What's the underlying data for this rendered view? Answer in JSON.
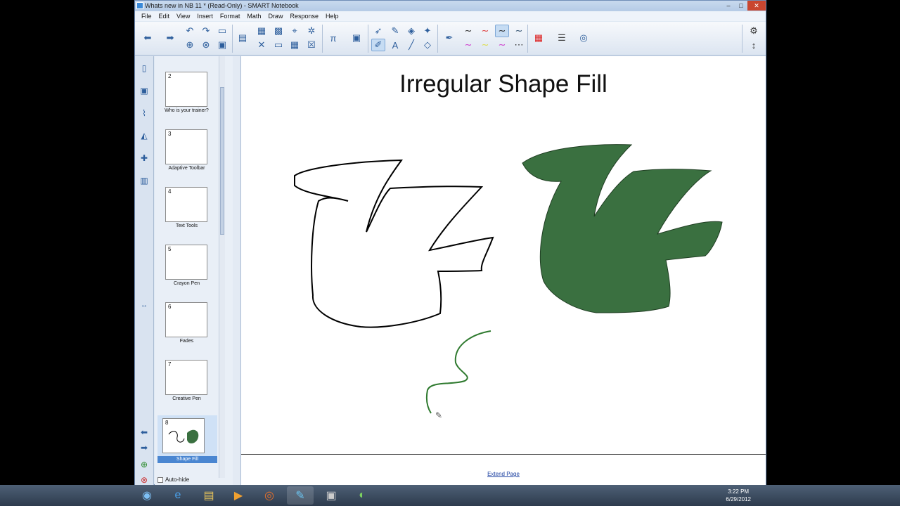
{
  "window": {
    "title": "Whats new in NB 11 * (Read-Only) - SMART Notebook",
    "controls": {
      "minimize": "–",
      "maximize": "□",
      "close": "✕"
    }
  },
  "menu": [
    "File",
    "Edit",
    "View",
    "Insert",
    "Format",
    "Math",
    "Draw",
    "Response",
    "Help"
  ],
  "toolbar": {
    "icons": [
      "back-icon",
      "forward-icon",
      "undo-icon",
      "redo-icon",
      "open-icon",
      "screen-shade-icon",
      "paste-icon",
      "insert-icon",
      "capture-icon",
      "share-icon",
      "pi-icon",
      "lock-icon",
      "select-icon",
      "pen-icon",
      "eraser-icon",
      "magic-pen-icon",
      "line-icon",
      "text-icon",
      "shape-icon",
      "fill-icon",
      "color-palette-icon",
      "line-style-icon",
      "transparency-icon",
      "settings-icon",
      "move-toolbar-icon"
    ]
  },
  "sorter": {
    "pages": [
      {
        "num": "2",
        "label": "Who is your trainer?"
      },
      {
        "num": "3",
        "label": "Adaptive Toolbar"
      },
      {
        "num": "4",
        "label": "Text Tools"
      },
      {
        "num": "5",
        "label": "Crayon Pen"
      },
      {
        "num": "6",
        "label": "Fades"
      },
      {
        "num": "7",
        "label": "Creative Pen"
      },
      {
        "num": "8",
        "label": "Shape Fill"
      }
    ],
    "auto_hide": "Auto-hide"
  },
  "page": {
    "title": "Irregular Shape Fill",
    "extend": "Extend Page",
    "fill_color": "#3a7040"
  },
  "taskbar": {
    "time": "3:22 PM",
    "date": "6/29/2012"
  }
}
